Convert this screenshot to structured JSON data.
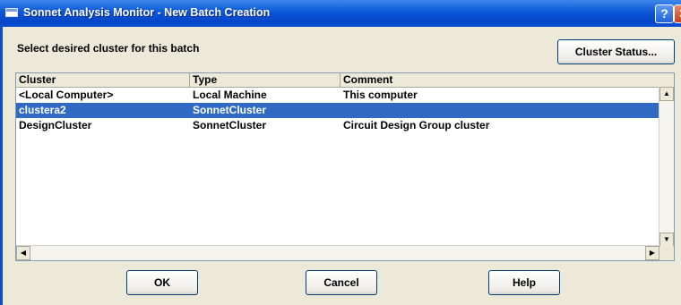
{
  "window": {
    "title": "Sonnet Analysis Monitor - New Batch Creation",
    "help_glyph": "?",
    "close_glyph": "✕"
  },
  "prompt": "Select desired cluster for this batch",
  "buttons": {
    "cluster_status": "Cluster Status...",
    "ok": "OK",
    "cancel": "Cancel",
    "help": "Help"
  },
  "list": {
    "columns": [
      "Cluster",
      "Type",
      "Comment"
    ],
    "rows": [
      {
        "cluster": "<Local Computer>",
        "type": "Local Machine",
        "comment": "This computer",
        "selected": false
      },
      {
        "cluster": "clustera2",
        "type": "SonnetCluster",
        "comment": "",
        "selected": true
      },
      {
        "cluster": "DesignCluster",
        "type": "SonnetCluster",
        "comment": "Circuit Design Group cluster",
        "selected": false
      }
    ]
  },
  "scrollbar_glyphs": {
    "up": "▲",
    "down": "▼",
    "left": "◀",
    "right": "▶"
  },
  "colors": {
    "titlebar": "#0a56d8",
    "selection": "#316ac5",
    "dialog_bg": "#ece9d8"
  }
}
